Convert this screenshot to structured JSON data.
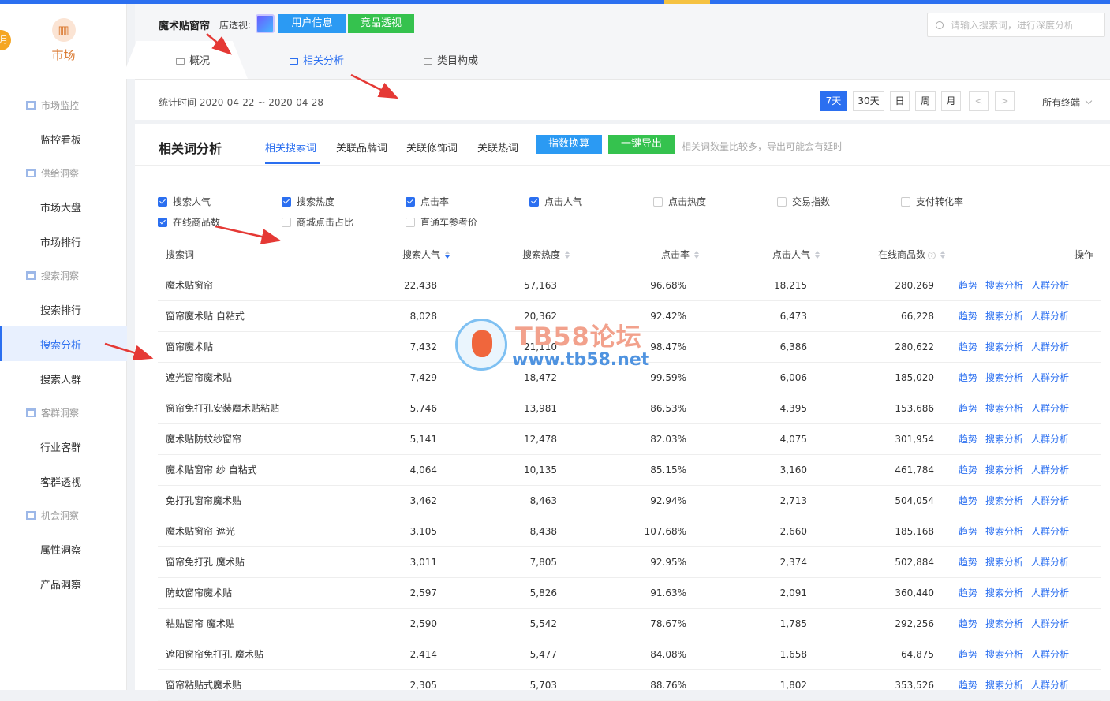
{
  "sidebar": {
    "badge": "月",
    "brand": "市场",
    "groups": [
      {
        "label": "市场监控",
        "items": [
          "监控看板"
        ]
      },
      {
        "label": "供给洞察",
        "items": [
          "市场大盘",
          "市场排行"
        ]
      },
      {
        "label": "搜索洞察",
        "items": [
          "搜索排行",
          "搜索分析",
          "搜索人群"
        ]
      },
      {
        "label": "客群洞察",
        "items": [
          "行业客群",
          "客群透视"
        ]
      },
      {
        "label": "机会洞察",
        "items": [
          "属性洞察",
          "产品洞察"
        ]
      }
    ],
    "active_item": "搜索分析"
  },
  "header": {
    "title": "魔术贴窗帘",
    "shop_label": "店透视:",
    "btn_user": "用户信息",
    "btn_compete": "竞品透视",
    "search_placeholder": "请输入搜索词，进行深度分析",
    "tabs": [
      "概况",
      "相关分析",
      "类目构成"
    ],
    "active_tab": "相关分析"
  },
  "datebar": {
    "stat_time": "统计时间 2020-04-22 ~ 2020-04-28",
    "periods": [
      "7天",
      "30天",
      "日",
      "周",
      "月"
    ],
    "active_period": "7天",
    "prev": "<",
    "next": ">",
    "terminal": "所有终端"
  },
  "card": {
    "title": "相关词分析",
    "subtabs": [
      "相关搜索词",
      "关联品牌词",
      "关联修饰词",
      "关联热词"
    ],
    "active_subtab": "相关搜索词",
    "btn_index": "指数换算",
    "btn_export": "一键导出",
    "note": "相关词数量比较多，导出可能会有延时",
    "metrics": [
      {
        "label": "搜索人气",
        "checked": true
      },
      {
        "label": "搜索热度",
        "checked": true
      },
      {
        "label": "点击率",
        "checked": true
      },
      {
        "label": "点击人气",
        "checked": true
      },
      {
        "label": "点击热度",
        "checked": false
      },
      {
        "label": "交易指数",
        "checked": false
      },
      {
        "label": "支付转化率",
        "checked": false
      },
      {
        "label": "在线商品数",
        "checked": true
      },
      {
        "label": "商城点击占比",
        "checked": false
      },
      {
        "label": "直通车参考价",
        "checked": false
      }
    ]
  },
  "table": {
    "headers": [
      "搜索词",
      "搜索人气",
      "搜索热度",
      "点击率",
      "点击人气",
      "在线商品数",
      "操作"
    ],
    "actions": [
      "趋势",
      "搜索分析",
      "人群分析"
    ],
    "rows": [
      [
        "魔术贴窗帘",
        "22,438",
        "57,163",
        "96.68%",
        "18,215",
        "280,269"
      ],
      [
        "窗帘魔术贴 自粘式",
        "8,028",
        "20,362",
        "92.42%",
        "6,473",
        "66,228"
      ],
      [
        "窗帘魔术贴",
        "7,432",
        "21,110",
        "98.47%",
        "6,386",
        "280,622"
      ],
      [
        "遮光窗帘魔术贴",
        "7,429",
        "18,472",
        "99.59%",
        "6,006",
        "185,020"
      ],
      [
        "窗帘免打孔安装魔术贴粘贴",
        "5,746",
        "13,981",
        "86.53%",
        "4,395",
        "153,686"
      ],
      [
        "魔术贴防蚊纱窗帘",
        "5,141",
        "12,478",
        "82.03%",
        "4,075",
        "301,954"
      ],
      [
        "魔术贴窗帘 纱 自粘式",
        "4,064",
        "10,135",
        "85.15%",
        "3,160",
        "461,784"
      ],
      [
        "免打孔窗帘魔术贴",
        "3,462",
        "8,463",
        "92.94%",
        "2,713",
        "504,054"
      ],
      [
        "魔术贴窗帘 遮光",
        "3,105",
        "8,438",
        "107.68%",
        "2,660",
        "185,168"
      ],
      [
        "窗帘免打孔 魔术贴",
        "3,011",
        "7,805",
        "92.95%",
        "2,374",
        "502,884"
      ],
      [
        "防蚊窗帘魔术贴",
        "2,597",
        "5,826",
        "91.63%",
        "2,091",
        "360,440"
      ],
      [
        "粘贴窗帘 魔术贴",
        "2,590",
        "5,542",
        "78.67%",
        "1,785",
        "292,256"
      ],
      [
        "遮阳窗帘免打孔 魔术贴",
        "2,414",
        "5,477",
        "84.08%",
        "1,658",
        "64,875"
      ],
      [
        "窗帘粘贴式魔术贴",
        "2,305",
        "5,703",
        "88.76%",
        "1,802",
        "353,526"
      ]
    ]
  },
  "watermark": {
    "line1": "TB58论坛",
    "line2": "www.tb58.net"
  },
  "colors": {
    "primary": "#2b6ff0",
    "green": "#35c24e",
    "light_blue": "#2b9af3",
    "brand_orange": "#d9762c",
    "annotation_red": "#e53935"
  }
}
